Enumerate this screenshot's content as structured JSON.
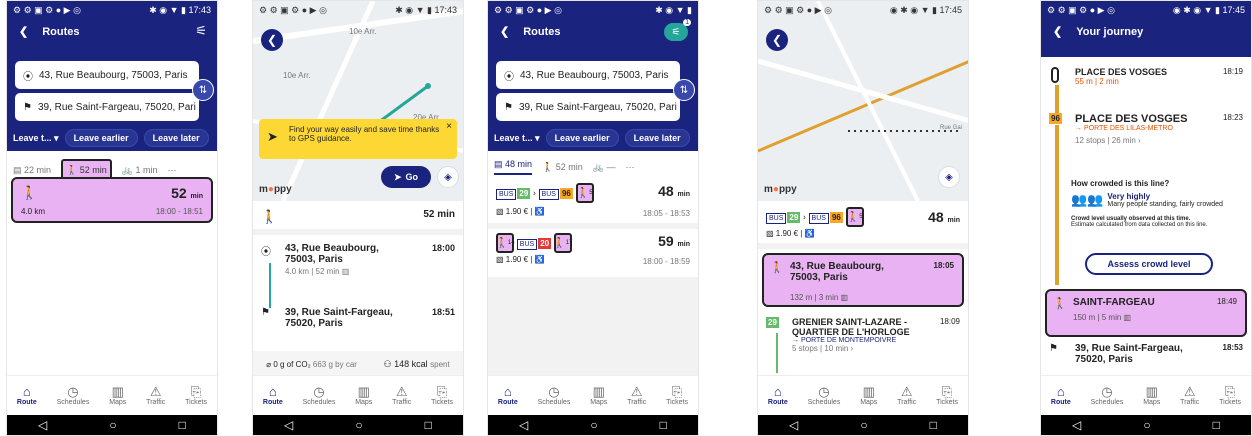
{
  "status": {
    "time1": "17:43",
    "time2": "17:43",
    "time4": "17:45",
    "time5": "17:45"
  },
  "colors": {
    "header": "#1a237e",
    "highlight": "#e9b2f2",
    "tooltip": "#fdd835"
  },
  "routes": {
    "title": "Routes",
    "from": "43, Rue Beaubourg, 75003, Paris",
    "to": "39, Rue Saint-Fargeau, 75020, Pari",
    "to3": "39, Rue Saint-Fargeau, 75020, Pari",
    "leave": "Leave t...",
    "earlier": "Leave earlier",
    "later": "Leave later",
    "mode_transit": "22 min",
    "mode_walk": "52 min",
    "mode_bike": "1 min",
    "mode_transit3": "48 min",
    "mode_walk3": "52 min",
    "badge": "1"
  },
  "walk_card": {
    "duration": "52",
    "unit": "min",
    "distance": "4.0 km",
    "times": "18:00 - 18:51"
  },
  "p2": {
    "tooltip": "Find your way easily and save time thanks to GPS guidance.",
    "go": "Go",
    "total": "52 min",
    "from_line1": "43, Rue Beaubourg,",
    "from_line2": "75003, Paris",
    "from_time": "18:00",
    "from_meta": "4.0 km | 52 min",
    "to_line1": "39, Rue Saint-Fargeau,",
    "to_line2": "75020, Paris",
    "to_time": "18:51",
    "co2": "0 g of CO₂",
    "co2_sub": "663 g by car",
    "kcal": "148 kcal",
    "kcal_sub": "spent",
    "map_labels": [
      "10e Arr.",
      "10e Arr.",
      "20e Arr."
    ]
  },
  "p3": {
    "r1_bus1": "29",
    "r1_bus2": "96",
    "r1_walk": "5",
    "r1_dur": "48",
    "r1_price": "1.90 €",
    "r1_times": "18:05 - 18:53",
    "r2_walk1": "14",
    "r2_bus": "20",
    "r2_walk2": "17",
    "r2_dur": "59",
    "r2_price": "1.90 €",
    "r2_times": "18:00 - 18:59",
    "unit": "min",
    "bus_label": "BUS"
  },
  "p4": {
    "dur": "48",
    "unit": "min",
    "price": "1.90 €",
    "s1_l1": "43, Rue Beaubourg,",
    "s1_l2": "75003, Paris",
    "s1_time": "18:05",
    "s1_meta": "132 m | 3 min",
    "s2_line": "29",
    "s2_l1": "GRENIER SAINT-LAZARE -",
    "s2_l2": "QUARTIER DE L'HORLOGE",
    "s2_time": "18:09",
    "s2_dir": "PORTE DE MONTEMPOIVRE",
    "s2_meta": "5 stops | 10 min",
    "map_label": "Rue Gai"
  },
  "p5": {
    "title": "Your journey",
    "s0": "PLACE DES VOSGES",
    "s0_time": "18:19",
    "s0_meta": "55 m | 2 min",
    "s1_line": "96",
    "s1": "PLACE DES VOSGES",
    "s1_time": "18:23",
    "s1_dir": "PORTE DES LILAS-METRO",
    "s1_meta": "12 stops | 26 min",
    "crowd_q": "How crowded is this line?",
    "crowd_lvl": "Very highly",
    "crowd_desc": "Many people standing, fairly crowded",
    "crowd_note": "Crowd level usually observed at this time.",
    "crowd_note2": "Estimate calculated from data collected on this line.",
    "assess": "Assess crowd level",
    "s2": "SAINT-FARGEAU",
    "s2_time": "18:49",
    "s2_meta": "150 m | 5 min",
    "s3_l1": "39, Rue Saint-Fargeau,",
    "s3_l2": "75020, Paris",
    "s3_time": "18:53"
  },
  "nav": {
    "route": "Route",
    "schedules": "Schedules",
    "maps": "Maps",
    "traffic": "Traffic",
    "tickets": "Tickets"
  },
  "brand": {
    "a": "m",
    "b": "ppy"
  }
}
